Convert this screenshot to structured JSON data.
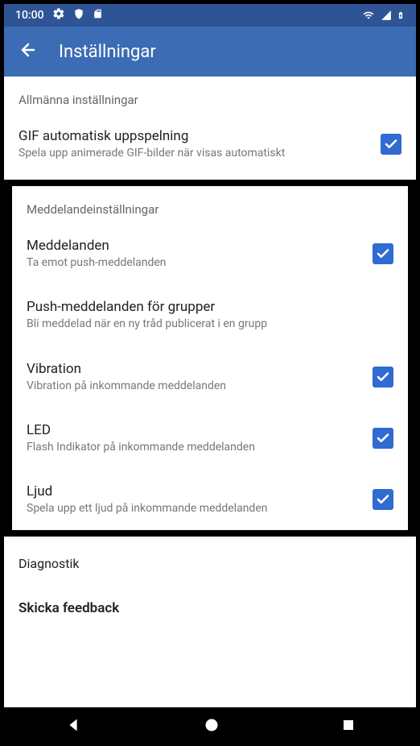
{
  "status": {
    "time": "10:00"
  },
  "header": {
    "title": "Inställningar"
  },
  "sections": {
    "general_header": "Allmänna inställningar",
    "gif": {
      "title": "GIF automatisk uppspelning",
      "subtitle": "Spela upp animerade GIF-bilder när visas automatiskt",
      "checked": true
    },
    "notif_header": "Meddelandeinställningar",
    "notifications": {
      "title": "Meddelanden",
      "subtitle": "Ta emot push-meddelanden",
      "checked": true
    },
    "group_push": {
      "title": "Push-meddelanden för grupper",
      "subtitle": "Bli meddelad när en ny tråd publicerat i en grupp"
    },
    "vibration": {
      "title": "Vibration",
      "subtitle": "Vibration på inkommande meddelanden",
      "checked": true
    },
    "led": {
      "title": "LED",
      "subtitle": "Flash Indikator på inkommande meddelanden",
      "checked": true
    },
    "sound": {
      "title": "Ljud",
      "subtitle": "Spela upp ett ljud på inkommande meddelanden",
      "checked": true
    },
    "diagnostics": "Diagnostik",
    "feedback": "Skicka feedback"
  }
}
